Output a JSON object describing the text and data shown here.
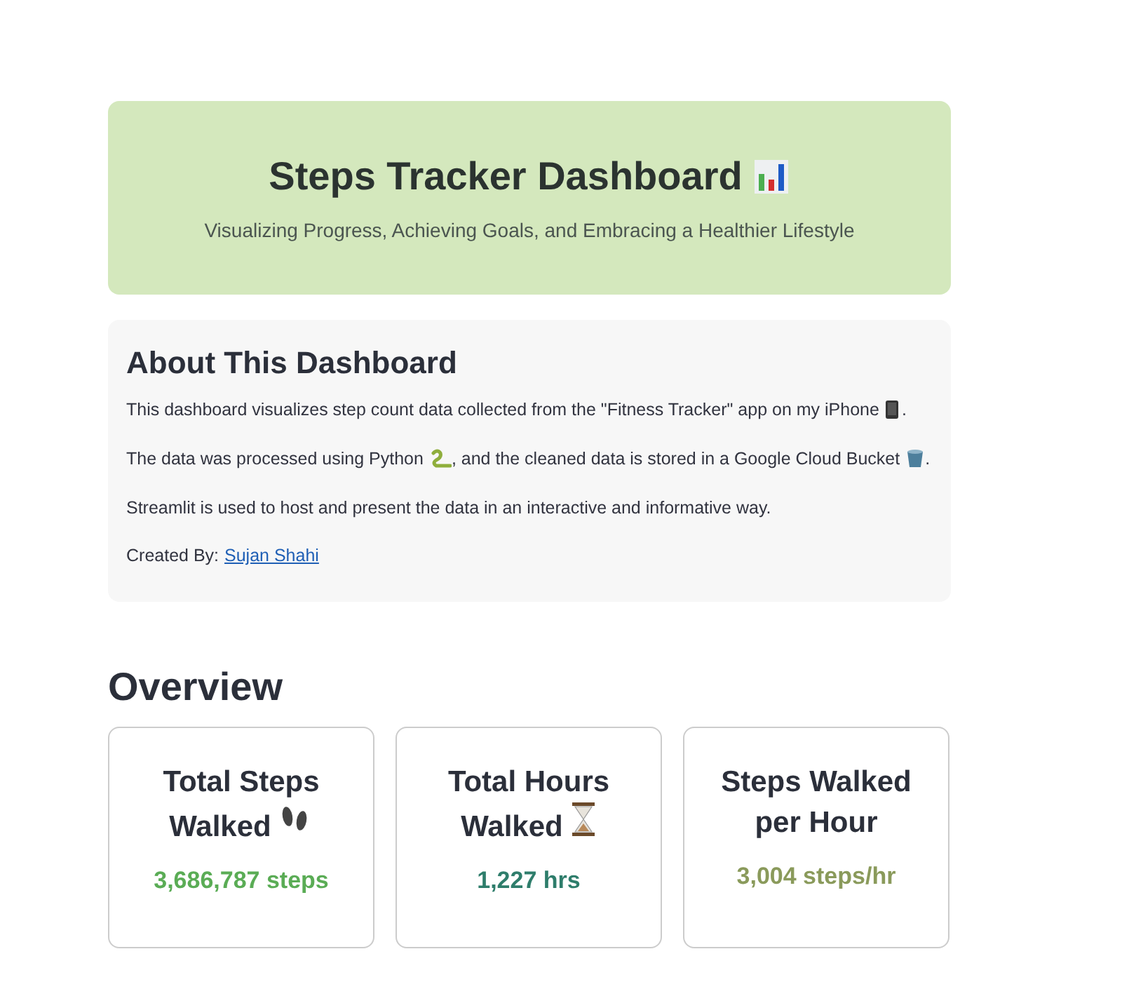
{
  "header": {
    "title": "Steps Tracker Dashboard",
    "subtitle": "Visualizing Progress, Achieving Goals, and Embracing a Healthier Lifestyle"
  },
  "about": {
    "heading": "About This Dashboard",
    "paragraphs": [
      [
        {
          "kind": "text",
          "text": "This dashboard visualizes step count data collected from the \"Fitness Tracker\" app on my iPhone"
        },
        {
          "kind": "phone"
        },
        {
          "kind": "text",
          "text": "."
        }
      ],
      [
        {
          "kind": "text",
          "text": "The data was processed using Python"
        },
        {
          "kind": "snake"
        },
        {
          "kind": "text",
          "text": ", and the cleaned data is stored in a Google Cloud Bucket"
        },
        {
          "kind": "bucket"
        },
        {
          "kind": "text",
          "text": "."
        }
      ],
      [
        {
          "kind": "text",
          "text": "Streamlit is used to host and present the data in an interactive and informative way."
        }
      ]
    ],
    "credit": {
      "label": "Created By:",
      "link": "Sujan Shahi"
    }
  },
  "overview": {
    "heading": "Overview",
    "cards": [
      {
        "title": "Total Steps Walked",
        "kind": "footprints",
        "value": "3,686,787 steps",
        "color": "#5aac55"
      },
      {
        "title": "Total Hours Walked",
        "kind": "hourglass",
        "value": "1,227 hrs",
        "color": "#2e7d6b"
      },
      {
        "title": "Steps Walked per Hour",
        "kind": "plain",
        "value": "3,004 steps/hr",
        "color": "#8a9a5b"
      }
    ]
  }
}
